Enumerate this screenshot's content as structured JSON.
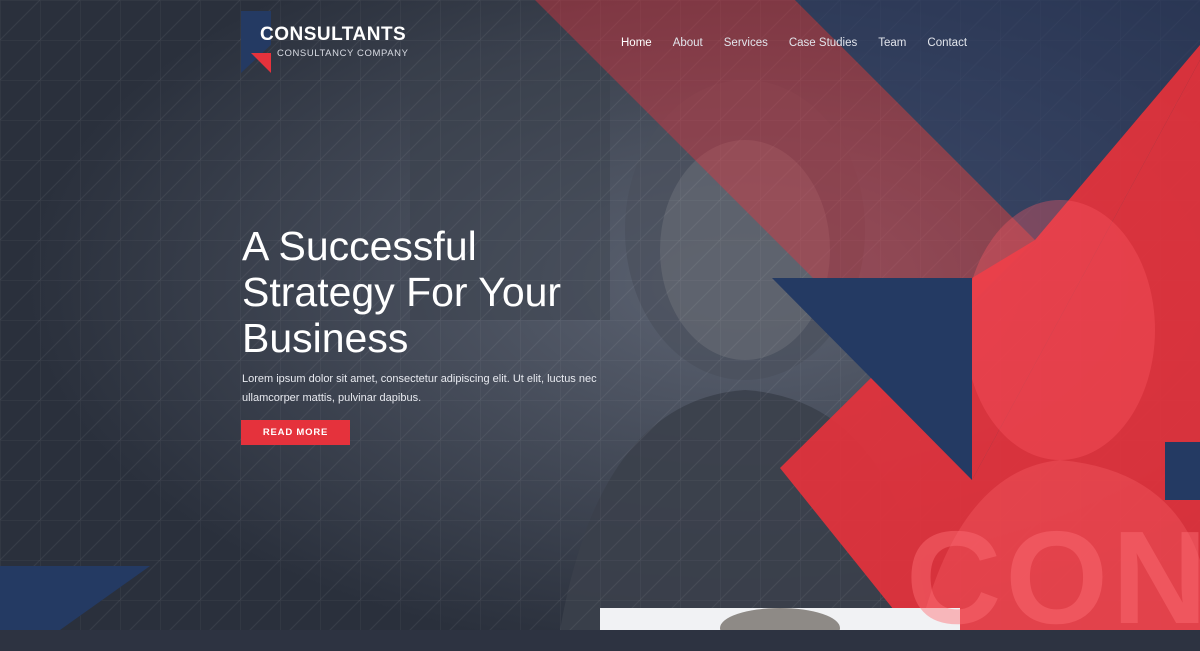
{
  "brand": {
    "name": "CONSULTANTS",
    "tagline": "CONSULTANCY COMPANY"
  },
  "nav": {
    "items": [
      "Home",
      "About",
      "Services",
      "Case Studies",
      "Team",
      "Contact"
    ],
    "active": "Home"
  },
  "hero": {
    "title_lines": [
      "A Successful",
      "Strategy For Your",
      "Business"
    ],
    "text": "Lorem ipsum dolor sit amet, consectetur adipiscing elit. Ut elit, luctus nec ullamcorper mattis, pulvinar dapibus.",
    "button_label": "READ MORE",
    "watermark": "CON"
  },
  "colors": {
    "navy": "#243a63",
    "red": "#e5323c",
    "dark_overlay": "#2d3341"
  }
}
